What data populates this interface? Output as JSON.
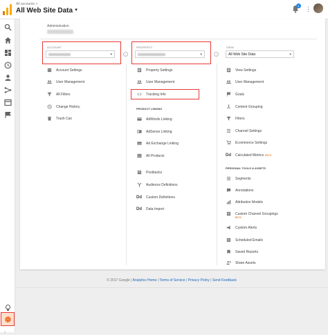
{
  "header": {
    "breadcrumb": "All accounts >",
    "title": "All Web Site Data",
    "notification_count": "1"
  },
  "admin": {
    "label": "Administration"
  },
  "columns": {
    "account": {
      "header": "ACCOUNT"
    },
    "property": {
      "header": "PROPERTY"
    },
    "view": {
      "header": "VIEW",
      "selected": "All Web Site Data"
    }
  },
  "account_items": [
    {
      "label": "Account Settings",
      "icon": "building-icon"
    },
    {
      "label": "User Management",
      "icon": "users-icon"
    },
    {
      "label": "All Filters",
      "icon": "filter-icon"
    },
    {
      "label": "Change History",
      "icon": "history-icon"
    },
    {
      "label": "Trash Can",
      "icon": "trash-icon"
    }
  ],
  "property_items": [
    {
      "label": "Property Settings",
      "icon": "settings-page-icon"
    },
    {
      "label": "User Management",
      "icon": "users-icon"
    },
    {
      "label": "Tracking Info",
      "icon": "code-icon"
    }
  ],
  "product_linking": {
    "header": "PRODUCT LINKING",
    "items": [
      {
        "label": "AdWords Linking",
        "icon": "adwords-icon"
      },
      {
        "label": "AdSense Linking",
        "icon": "adsense-icon"
      },
      {
        "label": "Ad Exchange Linking",
        "icon": "adexchange-icon"
      },
      {
        "label": "All Products",
        "icon": "grid-icon"
      }
    ]
  },
  "property_extra": [
    {
      "label": "Postbacks",
      "icon": "postbacks-icon"
    },
    {
      "label": "Audience Definitions",
      "icon": "audience-icon"
    },
    {
      "label": "Custom Definitions",
      "icon": "dd-icon",
      "glyph": "Dd"
    },
    {
      "label": "Data Import",
      "icon": "dd-icon",
      "glyph": "Dd"
    }
  ],
  "view_items": [
    {
      "label": "View Settings",
      "icon": "settings-page-icon"
    },
    {
      "label": "User Management",
      "icon": "users-icon"
    },
    {
      "label": "Goals",
      "icon": "flag-icon"
    },
    {
      "label": "Content Grouping",
      "icon": "grouping-icon"
    },
    {
      "label": "Filters",
      "icon": "filter-icon"
    },
    {
      "label": "Channel Settings",
      "icon": "channel-icon"
    },
    {
      "label": "Ecommerce Settings",
      "icon": "cart-icon"
    },
    {
      "label": "Calculated Metrics",
      "icon": "dd-icon",
      "glyph": "Dd",
      "beta": "BETA"
    }
  ],
  "personal_tools": {
    "header": "PERSONAL TOOLS & ASSETS",
    "items": [
      {
        "label": "Segments",
        "icon": "segments-icon"
      },
      {
        "label": "Annotations",
        "icon": "annotations-icon"
      },
      {
        "label": "Attribution Models",
        "icon": "attribution-icon"
      },
      {
        "label": "Custom Channel Groupings",
        "icon": "custom-channel-icon",
        "beta": "BETA"
      },
      {
        "label": "Custom Alerts",
        "icon": "megaphone-icon"
      },
      {
        "label": "Scheduled Emails",
        "icon": "email-icon"
      },
      {
        "label": "Saved Reports",
        "icon": "saved-reports-icon"
      },
      {
        "label": "Share Assets",
        "icon": "share-icon"
      }
    ]
  },
  "footer": {
    "copyright": "© 2017 Google",
    "links": [
      "Analytics Home",
      "Terms of Service",
      "Privacy Policy",
      "Send Feedback"
    ]
  },
  "colors": {
    "highlight": "#e53935",
    "admin_nav_bg": "#ffe0cc",
    "admin_icon": "#e65100",
    "link": "#1565c0"
  }
}
